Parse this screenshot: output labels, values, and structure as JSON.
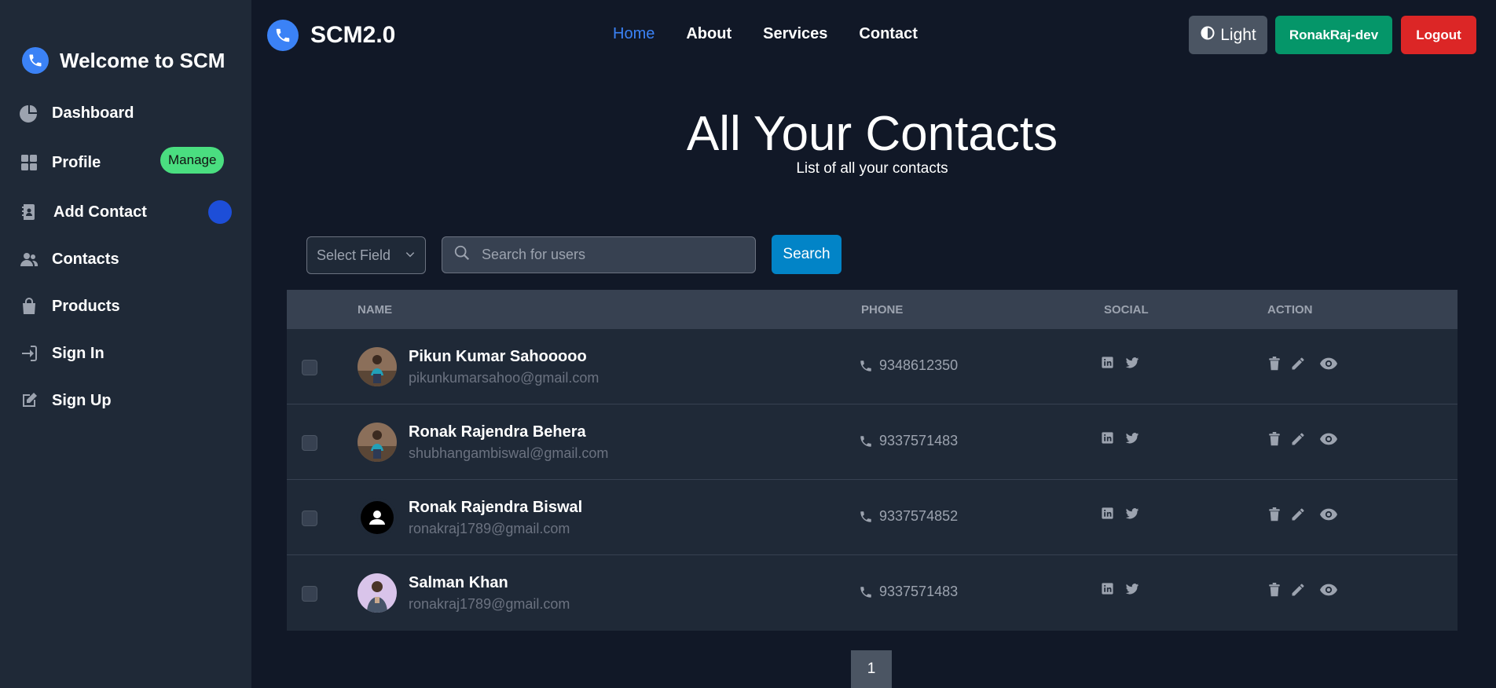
{
  "sidebar": {
    "brand": "Welcome to SCM",
    "items": [
      {
        "label": "Dashboard",
        "icon": "pie-chart-icon"
      },
      {
        "label": "Profile",
        "icon": "grid-icon",
        "badge": "Manage"
      },
      {
        "label": "Add Contact",
        "icon": "address-book-icon"
      },
      {
        "label": "Contacts",
        "icon": "users-icon"
      },
      {
        "label": "Products",
        "icon": "shopping-bag-icon"
      },
      {
        "label": "Sign In",
        "icon": "sign-in-icon"
      },
      {
        "label": "Sign Up",
        "icon": "pen-to-square-icon"
      }
    ]
  },
  "navbar": {
    "brand": "SCM2.0",
    "links": [
      "Home",
      "About",
      "Services",
      "Contact"
    ],
    "theme_label": "Light",
    "user_label": "RonakRaj-dev",
    "logout_label": "Logout"
  },
  "main": {
    "title": "All Your Contacts",
    "subtitle": "List of all your contacts",
    "select_placeholder": "Select Field",
    "search_placeholder": "Search for users",
    "search_button": "Search",
    "columns": [
      "NAME",
      "PHONE",
      "SOCIAL",
      "ACTION"
    ],
    "contacts": [
      {
        "name": "Pikun Kumar Sahooooo",
        "email": "pikunkumarsahoo@gmail.com",
        "phone": "9348612350"
      },
      {
        "name": "Ronak Rajendra Behera",
        "email": "shubhangambiswal@gmail.com",
        "phone": "9337571483"
      },
      {
        "name": "Ronak Rajendra Biswal",
        "email": "ronakraj1789@gmail.com",
        "phone": "9337574852"
      },
      {
        "name": "Salman Khan",
        "email": "ronakraj1789@gmail.com",
        "phone": "9337571483"
      }
    ],
    "page": "1"
  },
  "colors": {
    "background": "#111827",
    "sidebar": "#1f2937",
    "accent": "#3b82f6",
    "user_button": "#059669",
    "logout_button": "#dc2626",
    "search_button": "#0284c7",
    "manage_badge": "#4ade80"
  }
}
